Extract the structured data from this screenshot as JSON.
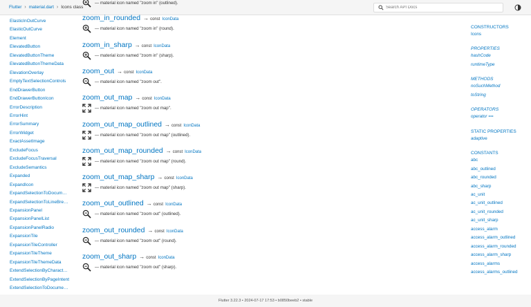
{
  "breadcrumb": {
    "root": "Flutter",
    "library": "material.dart",
    "current": "Icons class"
  },
  "search": {
    "placeholder": "Search API Docs"
  },
  "sidebar": {
    "items": [
      "ElasticInOutCurve",
      "ElasticOutCurve",
      "Element",
      "ElevatedButton",
      "ElevatedButtonTheme",
      "ElevatedButtonThemeData",
      "ElevationOverlay",
      "EmptyTextSelectionControls",
      "EndDrawerButton",
      "EndDrawerButtonIcon",
      "ErrorDescription",
      "ErrorHint",
      "ErrorSummary",
      "ErrorWidget",
      "ExactAssetImage",
      "ExcludeFocus",
      "ExcludeFocusTraversal",
      "ExcludeSemantics",
      "Expanded",
      "ExpandIcon",
      "ExpandSelectionToDocumentBoundaryIntent",
      "ExpandSelectionToLineBreakIntent",
      "ExpansionPanel",
      "ExpansionPanelList",
      "ExpansionPanelRadio",
      "ExpansionTile",
      "ExpansionTileController",
      "ExpansionTileTheme",
      "ExpansionTileThemeData",
      "ExtendSelectionByCharacterIntent",
      "ExtendSelectionByPageIntent",
      "ExtendSelectionToDocumentBoundaryIntent",
      "ExtendSelectionToLineBreakIntent"
    ]
  },
  "entries": [
    {
      "name": "",
      "desc": "— material icon named \"zoom in\" (outlined).",
      "icon": "zoom-in-icon"
    },
    {
      "name": "zoom_in_rounded",
      "desc": "— material icon named \"zoom in\" (round).",
      "icon": "zoom-in-icon"
    },
    {
      "name": "zoom_in_sharp",
      "desc": "— material icon named \"zoom in\" (sharp).",
      "icon": "zoom-in-icon"
    },
    {
      "name": "zoom_out",
      "desc": "— material icon named \"zoom out\".",
      "icon": "zoom-out-icon"
    },
    {
      "name": "zoom_out_map",
      "desc": "— material icon named \"zoom out map\".",
      "icon": "zoom-out-map-icon"
    },
    {
      "name": "zoom_out_map_outlined",
      "desc": "— material icon named \"zoom out map\" (outlined).",
      "icon": "zoom-out-map-icon"
    },
    {
      "name": "zoom_out_map_rounded",
      "desc": "— material icon named \"zoom out map\" (round).",
      "icon": "zoom-out-map-icon"
    },
    {
      "name": "zoom_out_map_sharp",
      "desc": "— material icon named \"zoom out map\" (sharp).",
      "icon": "zoom-out-map-icon"
    },
    {
      "name": "zoom_out_outlined",
      "desc": "— material icon named \"zoom out\" (outlined).",
      "icon": "zoom-out-icon"
    },
    {
      "name": "zoom_out_rounded",
      "desc": "— material icon named \"zoom out\" (round).",
      "icon": "zoom-out-icon"
    },
    {
      "name": "zoom_out_sharp",
      "desc": "— material icon named \"zoom out\" (sharp).",
      "icon": "zoom-out-icon"
    }
  ],
  "entry_labels": {
    "arrow": "→",
    "const": "const",
    "type": "IconData"
  },
  "right_nav": [
    {
      "kind": "section",
      "label": "CONSTRUCTORS"
    },
    {
      "kind": "link",
      "label": "Icons"
    },
    {
      "kind": "section-it",
      "label": "PROPERTIES"
    },
    {
      "kind": "link-it",
      "label": "hashCode"
    },
    {
      "kind": "link-it",
      "label": "runtimeType"
    },
    {
      "kind": "section-it",
      "label": "METHODS"
    },
    {
      "kind": "link-it",
      "label": "noSuchMethod"
    },
    {
      "kind": "link-it",
      "label": "toString"
    },
    {
      "kind": "section-it",
      "label": "OPERATORS"
    },
    {
      "kind": "link-it",
      "label": "operator =="
    },
    {
      "kind": "section",
      "label": "STATIC PROPERTIES"
    },
    {
      "kind": "link",
      "label": "adaptive"
    },
    {
      "kind": "section",
      "label": "CONSTANTS"
    },
    {
      "kind": "link",
      "label": "abc"
    },
    {
      "kind": "link",
      "label": "abc_outlined"
    },
    {
      "kind": "link",
      "label": "abc_rounded"
    },
    {
      "kind": "link",
      "label": "abc_sharp"
    },
    {
      "kind": "link",
      "label": "ac_unit"
    },
    {
      "kind": "link",
      "label": "ac_unit_outlined"
    },
    {
      "kind": "link",
      "label": "ac_unit_rounded"
    },
    {
      "kind": "link",
      "label": "ac_unit_sharp"
    },
    {
      "kind": "link",
      "label": "access_alarm"
    },
    {
      "kind": "link",
      "label": "access_alarm_outlined"
    },
    {
      "kind": "link",
      "label": "access_alarm_rounded"
    },
    {
      "kind": "link",
      "label": "access_alarm_sharp"
    },
    {
      "kind": "link",
      "label": "access_alarms"
    },
    {
      "kind": "link",
      "label": "access_alarms_outlined"
    }
  ],
  "footer": {
    "text": "Flutter 3.22.3 • 2024-07-17 17:53 • b0850beeb2 • stable"
  },
  "colors": {
    "link": "#0175c2",
    "header_bg": "#f5f5f5",
    "text": "#333333"
  }
}
